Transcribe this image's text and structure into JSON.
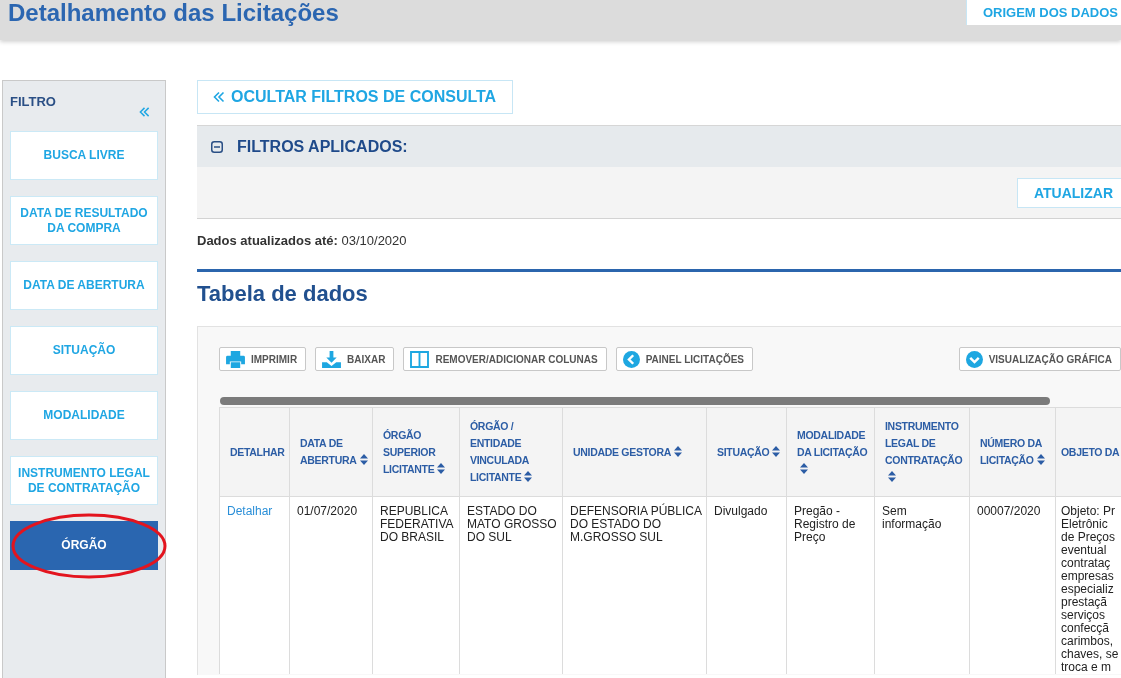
{
  "header": {
    "title": "Detalhamento das Licitações",
    "source_button": "ORIGEM DOS DADOS"
  },
  "sidebar": {
    "title": "FILTRO",
    "items": [
      {
        "label": "BUSCA LIVRE",
        "selected": false,
        "circled": false
      },
      {
        "label": "DATA DE RESULTADO DA COMPRA",
        "selected": false,
        "circled": false
      },
      {
        "label": "DATA DE ABERTURA",
        "selected": false,
        "circled": false
      },
      {
        "label": "SITUAÇÃO",
        "selected": false,
        "circled": false
      },
      {
        "label": "MODALIDADE",
        "selected": false,
        "circled": false
      },
      {
        "label": "INSTRUMENTO LEGAL DE CONTRATAÇÃO",
        "selected": false,
        "circled": false
      },
      {
        "label": "ÓRGÃO",
        "selected": true,
        "circled": true
      }
    ]
  },
  "hide_filters_button": "OCULTAR FILTROS DE CONSULTA",
  "applied_filters": {
    "title": "FILTROS APLICADOS:",
    "expanded": true,
    "update_button": "ATUALIZAR"
  },
  "updated_note": "**Dados atualizados até:** 03/10/2020",
  "data_table": {
    "title": "Tabela de dados",
    "toolbar": [
      {
        "label": "IMPRIMIR",
        "kind": "print"
      },
      {
        "label": "BAIXAR",
        "kind": "download"
      },
      {
        "label": "REMOVER/ADICIONAR COLUNAS",
        "kind": "columns"
      },
      {
        "label": "PAINEL LICITAÇÕES",
        "kind": "back"
      }
    ],
    "toolbar_right": [
      {
        "label": "VISUALIZAÇÃO GRÁFICA",
        "kind": "expand"
      }
    ],
    "columns": [
      {
        "label": "DETALHAR",
        "sortable": false
      },
      {
        "label": "DATA DE ABERTURA",
        "sortable": true
      },
      {
        "label": "ÓRGÃO SUPERIOR LICITANTE",
        "sortable": true
      },
      {
        "label": "ÓRGÃO / ENTIDADE VINCULADA LICITANTE",
        "sortable": true
      },
      {
        "label": "UNIDADE GESTORA",
        "sortable": true
      },
      {
        "label": "SITUAÇÃO",
        "sortable": true
      },
      {
        "label": "MODALIDADE DA LICITAÇÃO",
        "sortable": true
      },
      {
        "label": "INSTRUMENTO LEGAL DE CONTRATAÇÃO",
        "sortable": true
      },
      {
        "label": "NÚMERO DA LICITAÇÃO",
        "sortable": true
      },
      {
        "label": "OBJETO DA",
        "sortable": false
      }
    ],
    "rows": [
      {
        "cells": [
          {
            "text": "Detalhar",
            "kind": "link"
          },
          {
            "text": "01/07/2020",
            "kind": "text"
          },
          {
            "text": "REPUBLICA FEDERATIVA DO BRASIL",
            "kind": "text"
          },
          {
            "text": "ESTADO DO MATO GROSSO DO SUL",
            "kind": "text"
          },
          {
            "text": "DEFENSORIA PÚBLICA DO ESTADO DO M.GROSSO SUL",
            "kind": "text"
          },
          {
            "text": "Divulgado",
            "kind": "text"
          },
          {
            "text": "Pregão - Registro de Preço",
            "kind": "text"
          },
          {
            "text": "Sem informação",
            "kind": "text"
          },
          {
            "text": "00007/2020",
            "kind": "text"
          },
          {
            "text": "Objeto: Pr\nEletrônic\nde Preços\neventual\ncontrataç\nempresas\nespecializ\nprestaçã\nserviços\nconfecçã\ncarimbos,\nchaves, se\ntroca e m",
            "kind": "text"
          }
        ]
      }
    ]
  }
}
